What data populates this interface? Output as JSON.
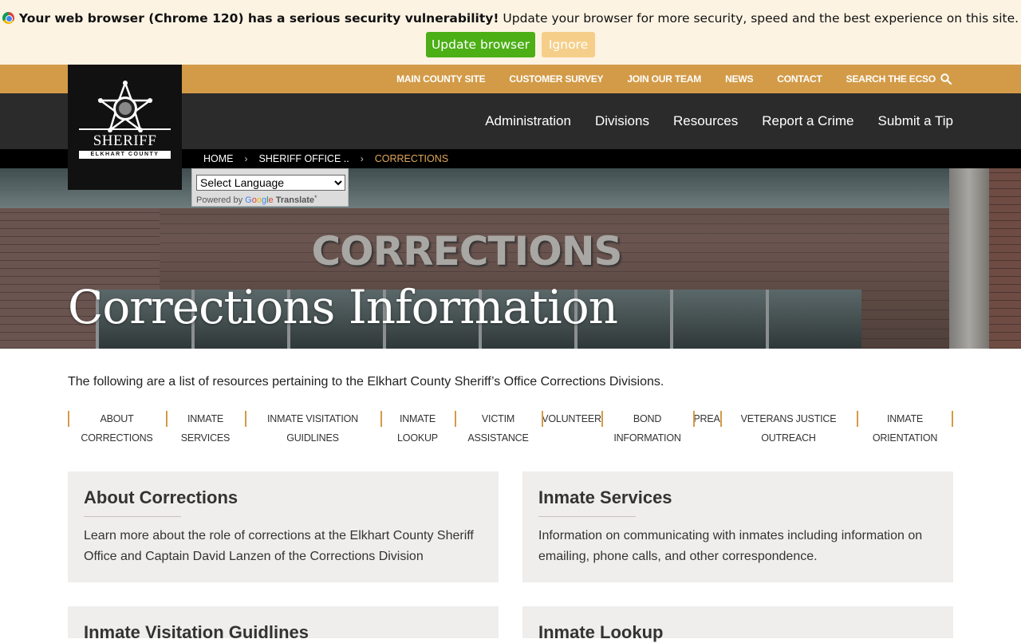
{
  "update_banner": {
    "bold_text": "Your web browser (Chrome 120) has a serious security vulnerability!",
    "text": " Update your browser for more security, speed and the best experience on this site.",
    "update_button": "Update browser",
    "ignore_button": "Ignore"
  },
  "utility_nav": {
    "items": [
      "MAIN COUNTY SITE",
      "CUSTOMER SURVEY",
      "JOIN OUR TEAM",
      "NEWS",
      "CONTACT"
    ],
    "search_label": "SEARCH THE ECSO"
  },
  "logo": {
    "title": "SHERIFF",
    "county": "ELKHART COUNTY"
  },
  "main_nav": {
    "items": [
      "Administration",
      "Divisions",
      "Resources",
      "Report a Crime",
      "Submit a Tip"
    ]
  },
  "breadcrumb": {
    "items": [
      "HOME",
      "SHERIFF OFFICE ..",
      "CORRECTIONS"
    ]
  },
  "translate": {
    "select_value": "Select Language",
    "powered_by": "Powered by",
    "google": [
      "G",
      "o",
      "o",
      "g",
      "l",
      "e"
    ],
    "translate_label": "Translate"
  },
  "hero": {
    "sign_text": "CORRECTIONS",
    "title": "Corrections Information"
  },
  "intro_text": "The following are a list of resources pertaining to the Elkhart County Sheriff’s Office Corrections Divisions.",
  "sub_nav": [
    {
      "label": "ABOUT\nCORRECTIONS"
    },
    {
      "label": "INMATE\nSERVICES"
    },
    {
      "label": "INMATE VISITATION\nGUIDLINES"
    },
    {
      "label": "INMATE\nLOOKUP"
    },
    {
      "label": "VICTIM\nASSISTANCE"
    },
    {
      "label": "VOLUNTEER"
    },
    {
      "label": "BOND\nINFORMATION"
    },
    {
      "label": "PREA"
    },
    {
      "label": "VETERANS JUSTICE\nOUTREACH"
    },
    {
      "label": "INMATE\nORIENTATION"
    }
  ],
  "cards": [
    {
      "title": "About Corrections",
      "description": "Learn more about the role of corrections at the Elkhart County Sheriff Office and Captain David Lanzen of the Corrections Division"
    },
    {
      "title": "Inmate Services",
      "description": "Information on communicating with inmates including information on emailing, phone calls, and other correspondence."
    },
    {
      "title": "Inmate Visitation Guidlines",
      "description": ""
    },
    {
      "title": "Inmate Lookup",
      "description": ""
    }
  ],
  "colors": {
    "accent_gold": "#d39b48",
    "nav_dark": "#2b2b2b",
    "update_green": "#4caf16",
    "ignore_tan": "#f5cf8a",
    "breadcrumb_current": "#e0a75a"
  }
}
